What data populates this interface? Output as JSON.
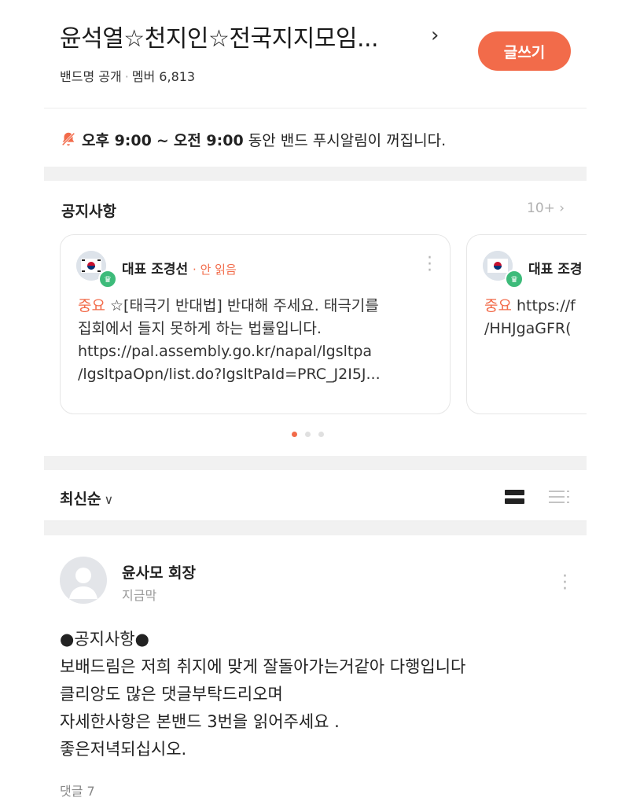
{
  "header": {
    "band_title": "윤석열☆천지인☆전국지지모임...",
    "band_type": "밴드명 공개",
    "member_label": "멤버 6,813",
    "write_button": "글쓰기"
  },
  "notification": {
    "start": "오후 9:00",
    "separator": "~",
    "end": "오전 9:00",
    "suffix": "동안 밴드 푸시알림이 꺼집니다."
  },
  "notices": {
    "title": "공지사항",
    "count": "10+",
    "cards": [
      {
        "author": "대표 조경선",
        "status": "· 안 읽음",
        "tag": "중요",
        "lines": [
          "☆[태극기 반대법] 반대해 주세요. 태극기를",
          "집회에서 들지 못하게 하는 법률입니다.",
          "https://pal.assembly.go.kr/napal/lgsltpa",
          "/lgsltpaOpn/list.do?lgsltPaId=PRC_J2I5J..."
        ]
      },
      {
        "author": "대표 조경",
        "tag": "중요",
        "lines": [
          "https://f",
          "/HHJgaGFR("
        ]
      }
    ],
    "page_index": 1,
    "page_total": 3
  },
  "sort": {
    "label": "최신순",
    "chevron": "∨"
  },
  "post": {
    "author": "윤사모 회장",
    "time": "지금막",
    "body_lines": [
      "●공지사항●",
      "보배드림은 저희 취지에 맞게 잘돌아가는거같아 다행입니다",
      "클리앙도 많은 댓글부탁드리오며",
      "자세한사항은 본밴드 3번을 읽어주세요 .",
      "좋은저녁되십시오."
    ],
    "comments": "댓글 7"
  },
  "colors": {
    "accent": "#f26b4a",
    "crown": "#3dbb7a"
  }
}
